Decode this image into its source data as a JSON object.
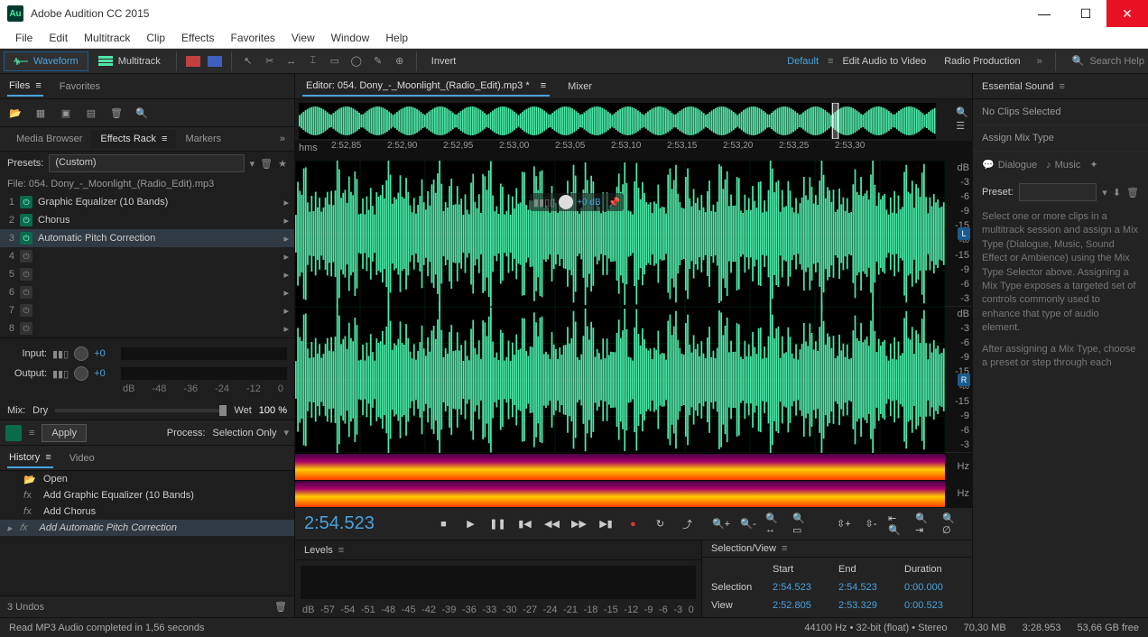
{
  "app": {
    "title": "Adobe Audition CC 2015",
    "logo": "Au"
  },
  "menu": [
    "File",
    "Edit",
    "Multitrack",
    "Clip",
    "Effects",
    "Favorites",
    "View",
    "Window",
    "Help"
  ],
  "toolbar": {
    "waveform": "Waveform",
    "multitrack": "Multitrack",
    "invert": "Invert",
    "workspaces": [
      "Default",
      "Edit Audio to Video",
      "Radio Production"
    ],
    "search_placeholder": "Search Help"
  },
  "left": {
    "tabs1": [
      "Files",
      "Favorites"
    ],
    "tabs2": [
      "Media Browser",
      "Effects Rack",
      "Markers"
    ],
    "presets_label": "Presets:",
    "presets_value": "(Custom)",
    "file_label": "File: 054. Dony_-_Moonlight_(Radio_Edit).mp3",
    "fx": [
      {
        "n": "1",
        "on": true,
        "name": "Graphic Equalizer (10 Bands)"
      },
      {
        "n": "2",
        "on": true,
        "name": "Chorus"
      },
      {
        "n": "3",
        "on": true,
        "name": "Automatic Pitch Correction"
      },
      {
        "n": "4",
        "on": false,
        "name": ""
      },
      {
        "n": "5",
        "on": false,
        "name": ""
      },
      {
        "n": "6",
        "on": false,
        "name": ""
      },
      {
        "n": "7",
        "on": false,
        "name": ""
      },
      {
        "n": "8",
        "on": false,
        "name": ""
      }
    ],
    "input_label": "Input:",
    "output_label": "Output:",
    "io_val": "+0",
    "db_ticks": [
      "dB",
      "-48",
      "-36",
      "-24",
      "-12",
      "0"
    ],
    "mix_label": "Mix:",
    "dry": "Dry",
    "wet": "Wet",
    "wet_val": "100 %",
    "apply": "Apply",
    "process_label": "Process:",
    "process_value": "Selection Only",
    "history_tabs": [
      "History",
      "Video"
    ],
    "history": [
      {
        "icon": "open",
        "label": "Open"
      },
      {
        "icon": "fx",
        "label": "Add Graphic Equalizer (10 Bands)"
      },
      {
        "icon": "fx",
        "label": "Add Chorus"
      },
      {
        "icon": "fx",
        "label": "Add Automatic Pitch Correction"
      }
    ],
    "undos": "3 Undos"
  },
  "editor": {
    "tab_label": "Editor: 054. Dony_-_Moonlight_(Radio_Edit).mp3 *",
    "mixer": "Mixer",
    "ruler_unit": "hms",
    "ruler_ticks": [
      "2:52,85",
      "2:52,90",
      "2:52,95",
      "2:53,00",
      "2:53,05",
      "2:53,10",
      "2:53,15",
      "2:53,20",
      "2:53,25",
      "2:53,30"
    ],
    "db_ticks": [
      "dB",
      "-3",
      "-6",
      "-9",
      "-15",
      "-∞",
      "-15",
      "-9",
      "-6",
      "-3",
      "dB"
    ],
    "hz": "Hz",
    "hud_val": "+0 dB",
    "timecode": "2:54.523"
  },
  "levels": {
    "title": "Levels",
    "ticks": [
      "dB",
      "-57",
      "-54",
      "-51",
      "-48",
      "-45",
      "-42",
      "-39",
      "-36",
      "-33",
      "-30",
      "-27",
      "-24",
      "-21",
      "-18",
      "-15",
      "-12",
      "-9",
      "-6",
      "-3",
      "0"
    ]
  },
  "selview": {
    "title": "Selection/View",
    "cols": [
      "Start",
      "End",
      "Duration"
    ],
    "rows": [
      {
        "label": "Selection",
        "start": "2:54.523",
        "end": "2:54.523",
        "dur": "0:00.000"
      },
      {
        "label": "View",
        "start": "2:52.805",
        "end": "2:53.329",
        "dur": "0:00.523"
      }
    ]
  },
  "right": {
    "title": "Essential Sound",
    "noclips": "No Clips Selected",
    "assign": "Assign Mix Type",
    "types": [
      "Dialogue",
      "Music"
    ],
    "preset_label": "Preset:",
    "help1": "Select one or more clips in a multitrack session and assign a Mix Type (Dialogue, Music, Sound Effect or Ambience) using the Mix Type Selector above. Assigning a Mix Type exposes a targeted set of controls commonly used to enhance that type of audio element.",
    "help2": "After assigning a Mix Type, choose a preset or step through each"
  },
  "status": {
    "msg": "Read MP3 Audio completed in 1,56 seconds",
    "sr": "44100 Hz",
    "bits": "32-bit (float)",
    "ch": "Stereo",
    "size": "70,30 MB",
    "dur": "3:28.953",
    "free": "53,66 GB free"
  }
}
